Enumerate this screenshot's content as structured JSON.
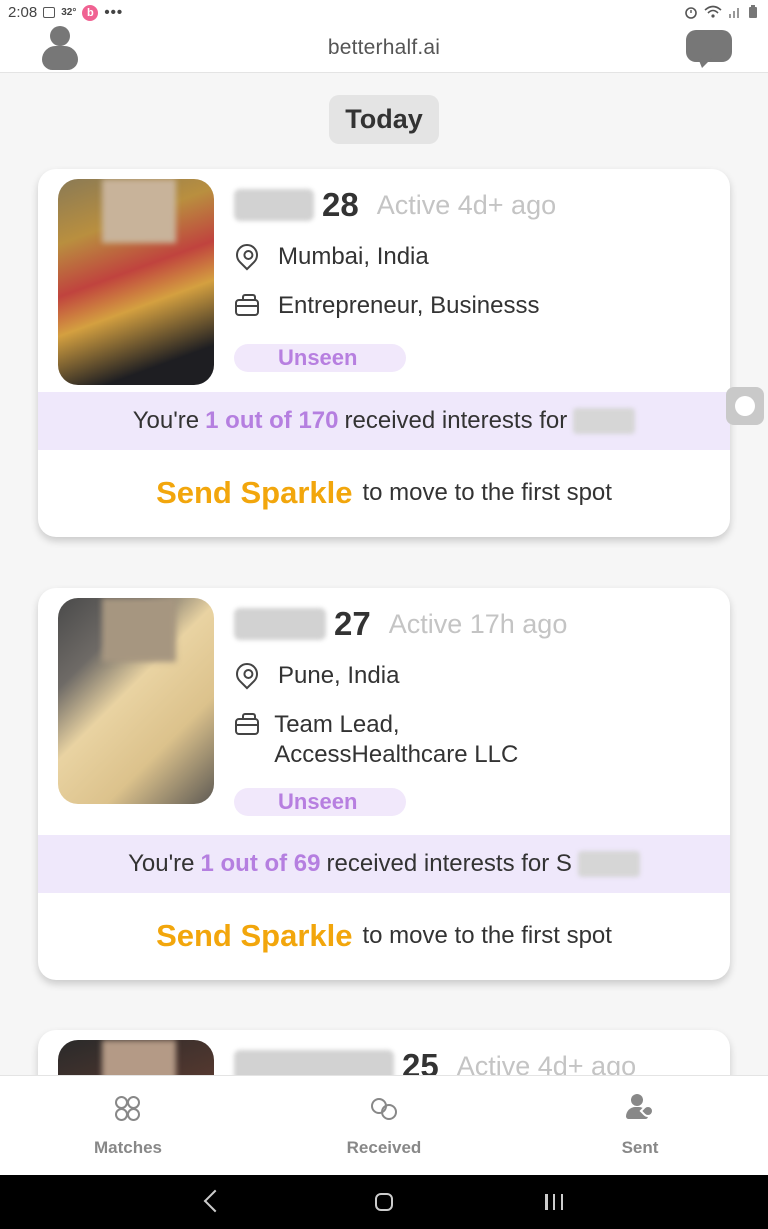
{
  "status_bar": {
    "time": "2:08",
    "temperature": "32°",
    "app_badge": "b",
    "more": "•••"
  },
  "app_bar": {
    "brand": "betterhalf.ai",
    "profile_icon": "person-icon",
    "chat_icon": "chat-bubble-icon"
  },
  "feed": {
    "day_label": "Today",
    "cards": [
      {
        "age": "28",
        "active": "Active 4d+ ago",
        "location": "Mumbai, India",
        "profession": "Entrepreneur, Businesss",
        "badge": "Unseen",
        "rank_prefix": "You're",
        "rank_value": "1 out of 170",
        "rank_suffix": "received interests for",
        "cta": "Send Sparkle",
        "cta_suffix": "to move to the first spot"
      },
      {
        "age": "27",
        "active": "Active 17h ago",
        "location": "Pune, India",
        "profession": "Team Lead, AccessHealthcare LLC",
        "badge": "Unseen",
        "rank_prefix": "You're",
        "rank_value": "1 out of 69",
        "rank_suffix": "received interests for S",
        "cta": "Send Sparkle",
        "cta_suffix": "to move to the first spot"
      },
      {
        "age": "25",
        "active": "Active 4d+ ago"
      }
    ]
  },
  "bottom_nav": {
    "items": [
      {
        "label": "Matches",
        "icon": "matches-icon"
      },
      {
        "label": "Received",
        "icon": "received-icon"
      },
      {
        "label": "Sent",
        "icon": "sent-icon"
      }
    ]
  }
}
